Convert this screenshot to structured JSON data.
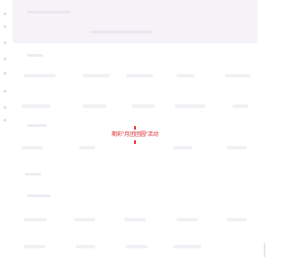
{
  "loader": {
    "text": "期彩“月团团圆”活动",
    "color": "#e8322f"
  },
  "icons": {
    "loading": "loading-crosshair-icon"
  },
  "colors": {
    "hero_background": "#f6f3f8",
    "placeholder": "#f1f1f5"
  }
}
